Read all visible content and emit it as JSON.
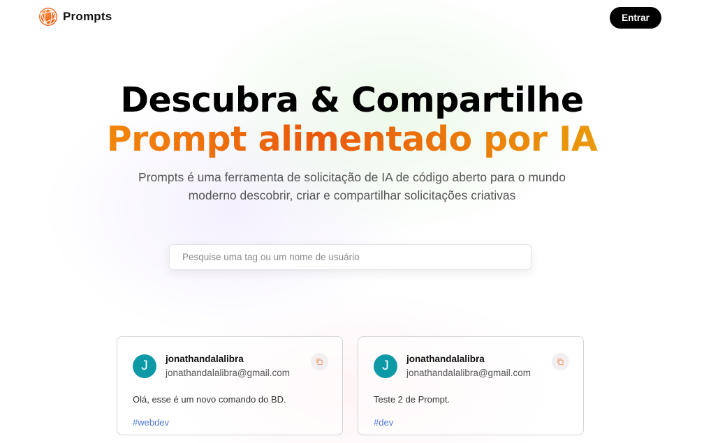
{
  "brand": {
    "name": "Prompts",
    "logo_icon": "globe-network-icon",
    "accent": "#ea580c"
  },
  "nav": {
    "login_label": "Entrar"
  },
  "hero": {
    "title": "Descubra & Compartilhe",
    "subtitle": "Prompt alimentado por IA",
    "description": "Prompts é uma ferramenta de solicitação de IA de código aberto para o mundo moderno descobrir, criar e compartilhar solicitações criativas"
  },
  "search": {
    "placeholder": "Pesquise uma tag ou um nome de usuário",
    "value": ""
  },
  "cards": [
    {
      "avatar_letter": "J",
      "username": "jonathandalalibra",
      "email": "jonathandalalibra@gmail.com",
      "prompt": "Olá, esse é um novo comando do BD.",
      "tag": "#webdev",
      "copy_icon": "copy-icon"
    },
    {
      "avatar_letter": "J",
      "username": "jonathandalalibra",
      "email": "jonathandalalibra@gmail.com",
      "prompt": "Teste 2 de Prompt.",
      "tag": "#dev",
      "copy_icon": "copy-icon"
    }
  ],
  "colors": {
    "avatar": "#0d9aa6",
    "tag": "#4f7ad8",
    "gradient_start": "#f59e0b",
    "gradient_mid": "#ea580c",
    "gradient_end": "#eab308"
  }
}
